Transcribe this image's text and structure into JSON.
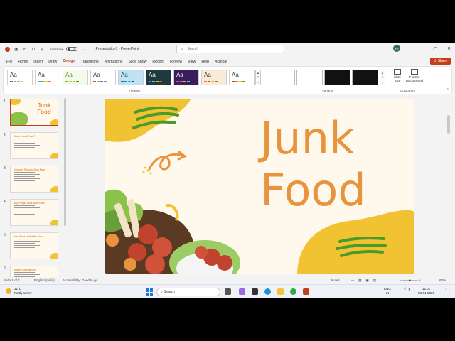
{
  "window": {
    "autosave_label": "AutoSave",
    "autosave_state": "Off",
    "doc_title": "Presentation1 • PowerPoint",
    "search_placeholder": "Search",
    "avatar_initials": "RI"
  },
  "tabs": [
    "File",
    "Home",
    "Insert",
    "Draw",
    "Design",
    "Transitions",
    "Animations",
    "Slide Show",
    "Record",
    "Review",
    "View",
    "Help",
    "Acrobat"
  ],
  "active_tab": "Design",
  "share_label": "Share",
  "ribbon": {
    "theme_sample": "Aa",
    "themes_label": "Themes",
    "variants_label": "Variants",
    "customize_label": "Customize",
    "slide_size_label": "Slide Size",
    "format_bg_label": "Format Background"
  },
  "slides": [
    {
      "num": "1",
      "title": "Junk Food"
    },
    {
      "num": "2",
      "title": "What is Junk Food?"
    },
    {
      "num": "3",
      "title": "Common Types of Junk Food"
    },
    {
      "num": "4",
      "title": "Why People Love Junk Food"
    },
    {
      "num": "5",
      "title": "Junk Food vs Healthy Food"
    },
    {
      "num": "6",
      "title": "Healthy Alternatives"
    }
  ],
  "main_slide": {
    "title_line1": "Junk",
    "title_line2": "Food"
  },
  "colors": {
    "accent": "#c43e1c",
    "title_orange": "#e8943e",
    "blob_yellow": "#f1c232",
    "squiggle_green": "#4c9a2a",
    "slide_bg": "#fff8ec"
  },
  "status": {
    "slide_info": "Slide 1 of 7",
    "language": "English (India)",
    "accessibility": "Accessibility: Good to go",
    "notes": "Notes",
    "zoom": "62%"
  },
  "taskbar": {
    "temp": "31°C",
    "weather": "Partly sunny",
    "search_label": "Search",
    "lang1": "ENG",
    "lang2": "IN",
    "time": "12:01",
    "date": "28-04-2026"
  }
}
